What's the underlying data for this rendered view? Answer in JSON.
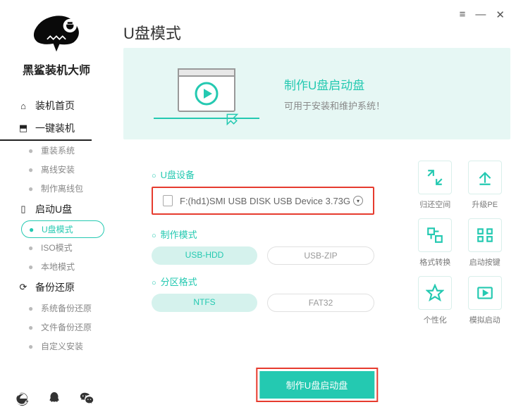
{
  "brand": {
    "name": "黑鲨装机大师"
  },
  "nav": {
    "home": "装机首页",
    "onekey": "一键装机",
    "onekey_sub": {
      "reinstall": "重装系统",
      "offline": "离线安装",
      "make_offline": "制作离线包"
    },
    "boot": "启动U盘",
    "boot_sub": {
      "usb_mode": "U盘模式",
      "iso_mode": "ISO模式",
      "local_mode": "本地模式"
    },
    "backup": "备份还原",
    "backup_sub": {
      "sys": "系统备份还原",
      "file": "文件备份还原",
      "custom": "自定义安装"
    }
  },
  "main": {
    "title": "U盘模式",
    "banner": {
      "title": "制作U盘启动盘",
      "subtitle": "可用于安装和维护系统！"
    },
    "sections": {
      "device_label": "U盘设备",
      "device_value": "F:(hd1)SMI USB DISK USB Device 3.73G",
      "mode_label": "制作模式",
      "mode_opts": {
        "hdd": "USB-HDD",
        "zip": "USB-ZIP"
      },
      "format_label": "分区格式",
      "format_opts": {
        "ntfs": "NTFS",
        "fat32": "FAT32"
      }
    },
    "tools": {
      "restore_space": "归还空间",
      "upgrade_pe": "升级PE",
      "format_convert": "格式转换",
      "boot_key": "启动按键",
      "personalize": "个性化",
      "simulate_boot": "模拟启动"
    },
    "create_button": "制作U盘启动盘"
  }
}
